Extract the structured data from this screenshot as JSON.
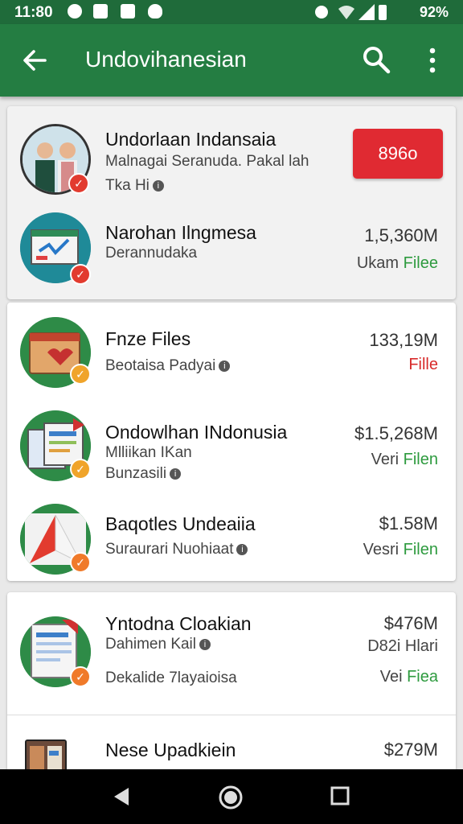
{
  "status": {
    "time": "11:80",
    "battery_text": "92%"
  },
  "appbar": {
    "title": "Undovihanesian"
  },
  "items": [
    {
      "title": "Undorlaan Indansaia",
      "subtitle": "Malnagai Seranuda. Pakal lah",
      "meta": "Tka Hi",
      "button_label": "896o"
    },
    {
      "title": "Narohan Ilngmesa",
      "subtitle": "Derannudaka",
      "size": "1,5,360M",
      "right_prefix": "Ukam ",
      "right_suffix": "Filee"
    },
    {
      "title": "Fnze Files",
      "subtitle": "Beotaisa Padyai",
      "size": "133,19M",
      "right_suffix": "Fille"
    },
    {
      "title": "Ondowlhan INdonusia",
      "subtitle": "Mlliikan IKan",
      "meta": "Bunzasili",
      "size": "$1.5,268M",
      "right_prefix": "Veri ",
      "right_suffix": "Filen"
    },
    {
      "title": "Baqotles Undeaiia",
      "subtitle": "Suraurari Nuohiaat",
      "size": "$1.58M",
      "right_prefix": "Vesri ",
      "right_suffix": "Filen"
    },
    {
      "title": "Yntodna Cloakian",
      "subtitle": "Dahimen Kail",
      "meta": "Dekalide 7layaioisa",
      "size": "$476M",
      "right_mid": "D82i Hlari",
      "right_prefix": "Vei ",
      "right_suffix": "Fiea"
    },
    {
      "title": "Nese Upadkiein",
      "size": "$279M"
    }
  ],
  "colors": {
    "appbar": "#247d42",
    "statusbar": "#1f6b3a",
    "accent_red": "#e02a32",
    "green_text": "#2e9b3f",
    "badge_red": "#e23b2f",
    "badge_orange": "#f0a42a"
  },
  "icons": {
    "nav_back": "back-triangle-icon",
    "nav_home": "home-circle-icon",
    "nav_recent": "recent-square-icon"
  }
}
